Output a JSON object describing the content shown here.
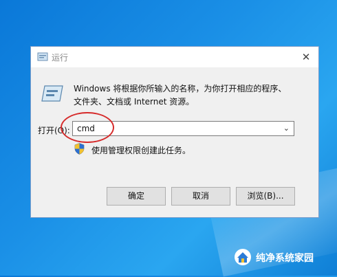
{
  "dialog": {
    "title": "运行",
    "close_symbol": "✕",
    "description_line1": "Windows 将根据你所输入的名称，为你打开相应的程序、",
    "description_line2": "文件夹、文档或 Internet 资源。",
    "open_label": "打开(O):",
    "input_value": "cmd",
    "admin_note": "使用管理权限创建此任务。",
    "buttons": {
      "ok": "确定",
      "cancel": "取消",
      "browse": "浏览(B)..."
    }
  },
  "watermark": {
    "text": "纯净系统家园"
  },
  "icons": {
    "title": "run-icon",
    "main": "run-icon",
    "shield": "shield-icon",
    "close": "close-icon",
    "dropdown": "chevron-down-icon",
    "watermark_logo": "house-logo-icon"
  },
  "colors": {
    "desktop": "#1a8fe6",
    "annotation": "#d62b2b"
  }
}
